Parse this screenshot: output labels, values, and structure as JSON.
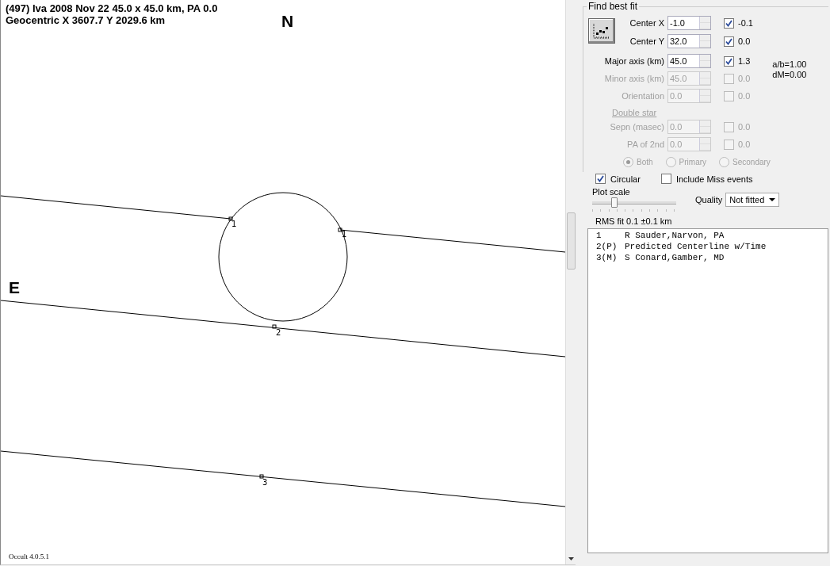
{
  "plot": {
    "title": "(497) Iva  2008 Nov 22  45.0 x 45.0 km, PA 0.0",
    "subtitle": "Geocentric  X  3607.7  Y 2029.6 km",
    "north_label": "N",
    "east_label": "E",
    "chords": [
      {
        "labels": [
          "1",
          "1"
        ]
      },
      {
        "labels": [
          "2"
        ]
      },
      {
        "labels": [
          "3"
        ]
      }
    ],
    "version": "Occult 4.0.5.1"
  },
  "fit": {
    "group_title": "Find best fit",
    "center_params": [
      {
        "label": "Center X",
        "value": "-1.0",
        "disabled": false,
        "checked": true,
        "delta": "-0.1"
      },
      {
        "label": "Center Y",
        "value": "32.0",
        "disabled": false,
        "checked": true,
        "delta": "0.0"
      }
    ],
    "shape_params": [
      {
        "label": "Major axis (km)",
        "value": "45.0",
        "disabled": false,
        "checked": true,
        "delta": "1.3"
      },
      {
        "label": "Minor axis (km)",
        "value": "45.0",
        "disabled": true,
        "checked": false,
        "delta": "0.0"
      },
      {
        "label": "Orientation",
        "value": "0.0",
        "disabled": true,
        "checked": false,
        "delta": "0.0"
      }
    ],
    "ratio": "a/b=1.00",
    "dm": "dM=0.00",
    "double_star_link": "Double star",
    "double_params": [
      {
        "label": "Sepn (masec)",
        "value": "0.0",
        "disabled": true,
        "checked": false,
        "delta": "0.0"
      },
      {
        "label": "PA of 2nd",
        "value": "0.0",
        "disabled": true,
        "checked": false,
        "delta": "0.0"
      }
    ],
    "radios": [
      {
        "label": "Both",
        "selected": true,
        "disabled": true
      },
      {
        "label": "Primary",
        "selected": false,
        "disabled": true
      },
      {
        "label": "Secondary",
        "selected": false,
        "disabled": true
      }
    ],
    "options": [
      {
        "label": "Circular",
        "checked": true
      },
      {
        "label": "Include Miss events",
        "checked": false
      }
    ],
    "plot_scale": {
      "label": "Plot scale",
      "level": 0.25
    },
    "quality": {
      "label": "Quality",
      "value": "Not fitted"
    },
    "rms": "RMS fit 0.1 ±0.1 km",
    "observers": [
      {
        "index": "1",
        "text": "R Sauder,Narvon, PA"
      },
      {
        "index": "2(P)",
        "text": "Predicted Centerline w/Time"
      },
      {
        "index": "3(M)",
        "text": "S Conard,Gamber, MD"
      }
    ]
  }
}
